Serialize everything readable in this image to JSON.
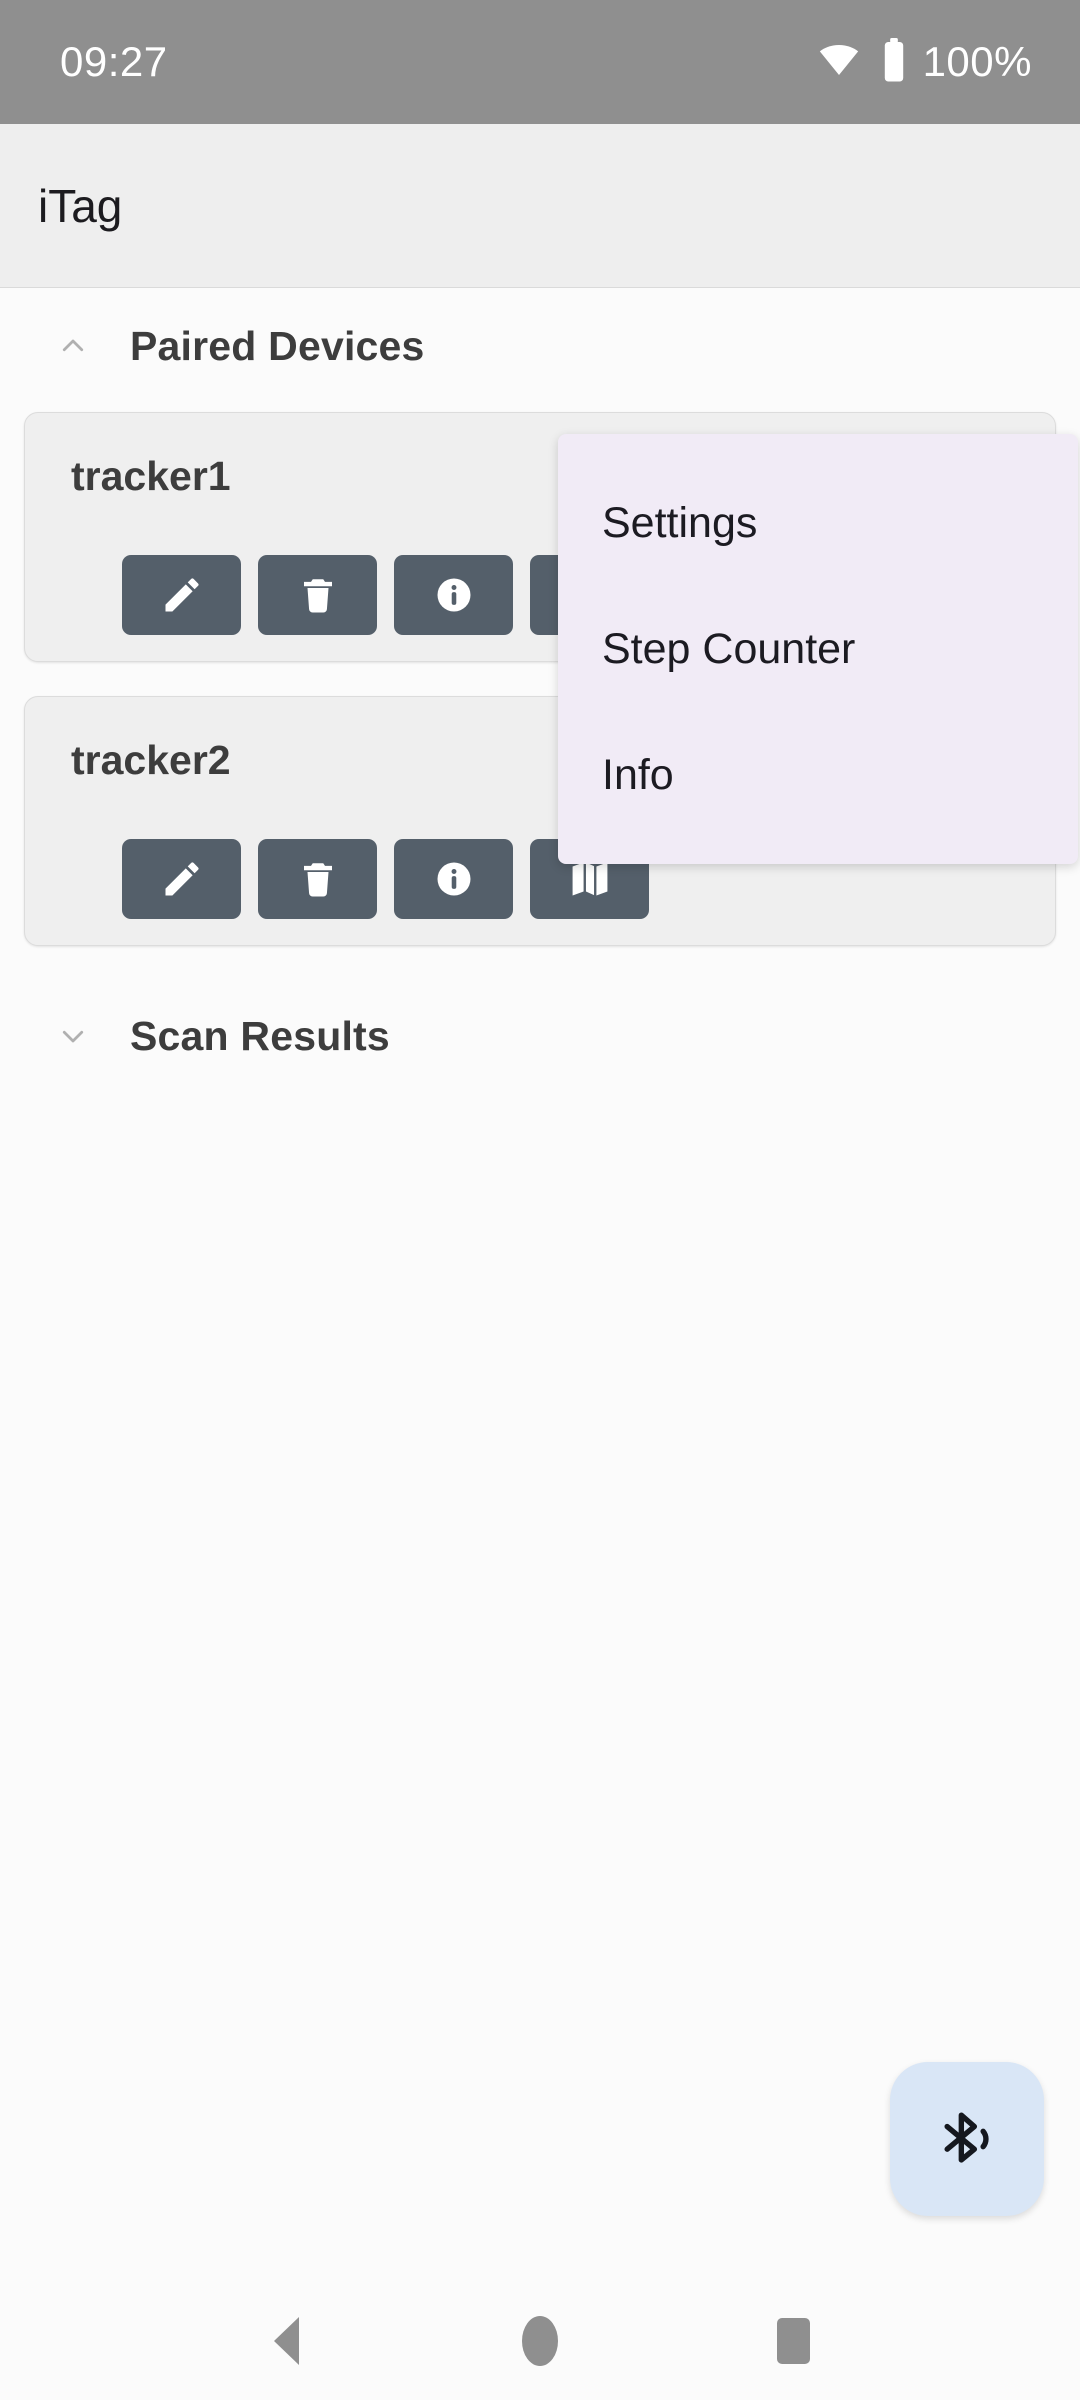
{
  "status_bar": {
    "time": "09:27",
    "battery_text": "100%",
    "wifi_icon": "wifi-icon",
    "battery_icon": "battery-full-icon",
    "background": "#8f8f8f"
  },
  "app_bar": {
    "title": "iTag",
    "background": "#eeeeee"
  },
  "overflow_menu": {
    "background": "#f1ebf6",
    "items": [
      {
        "label": "Settings",
        "name": "menu-item-settings"
      },
      {
        "label": "Step Counter",
        "name": "menu-item-step-counter"
      },
      {
        "label": "Info",
        "name": "menu-item-info"
      }
    ]
  },
  "sections": [
    {
      "title": "Paired Devices",
      "expanded": true,
      "chevron_icon": "chevron-up-icon"
    },
    {
      "title": "Scan Results",
      "expanded": false,
      "chevron_icon": "chevron-down-icon"
    }
  ],
  "devices": [
    {
      "name": "tracker1",
      "bluetooth_icon": "bluetooth-icon",
      "actions": [
        {
          "icon": "edit-pencil-icon",
          "name": "edit-button"
        },
        {
          "icon": "trash-delete-icon",
          "name": "delete-button"
        },
        {
          "icon": "info-circle-icon",
          "name": "info-button"
        },
        {
          "icon": "map-icon",
          "name": "map-button"
        }
      ]
    },
    {
      "name": "tracker2",
      "bluetooth_icon": "bluetooth-icon",
      "actions": [
        {
          "icon": "edit-pencil-icon",
          "name": "edit-button"
        },
        {
          "icon": "trash-delete-icon",
          "name": "delete-button"
        },
        {
          "icon": "info-circle-icon",
          "name": "info-button"
        },
        {
          "icon": "map-icon",
          "name": "map-button"
        }
      ]
    }
  ],
  "fab": {
    "icon": "bluetooth-searching-icon",
    "background": "#d9e6f6"
  },
  "nav_bar": {
    "back_icon": "back-triangle-icon",
    "home_icon": "home-circle-icon",
    "recents_icon": "recents-square-icon"
  },
  "colors": {
    "action_button": "#545f6a",
    "card_background": "#efefef",
    "bt_toggle": "#dde2ec",
    "page_background": "#fbfbfb"
  }
}
